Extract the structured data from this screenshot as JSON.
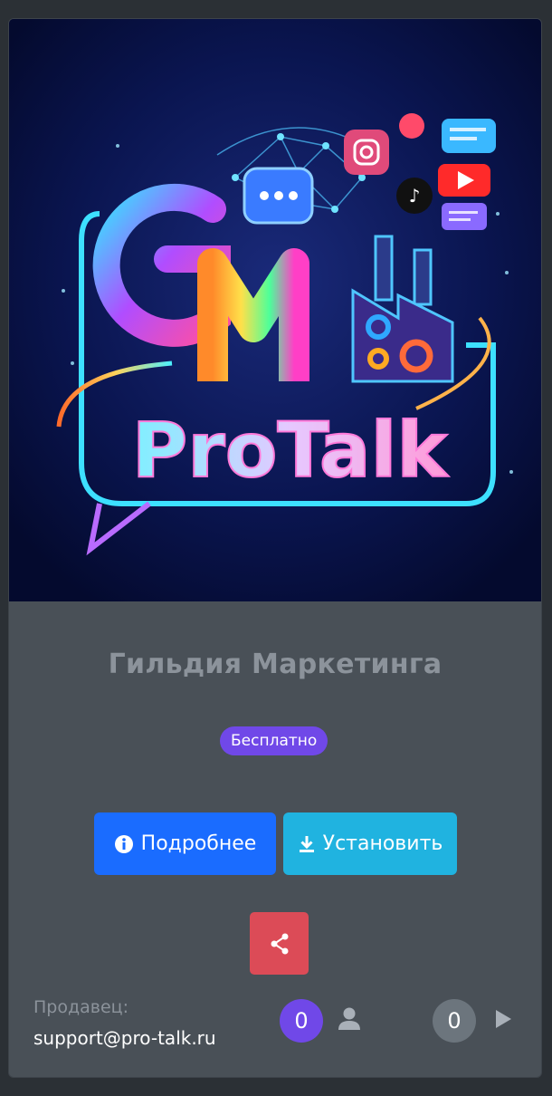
{
  "product": {
    "image_alt": "GM ProTalk logo",
    "logo_text": "ProTalk",
    "logo_letters": "GM",
    "title": "Гильдия Маркетинга",
    "price_badge": "Бесплатно"
  },
  "actions": {
    "details_label": "Подробнее",
    "install_label": "Установить",
    "share_icon": "share-icon"
  },
  "seller": {
    "label": "Продавец:",
    "email": "support@pro-talk.ru"
  },
  "stats": {
    "users_count": "0",
    "plays_count": "0"
  },
  "colors": {
    "card_bg": "#495057",
    "badge": "#7048e8",
    "primary": "#1a6cff",
    "info": "#20b3e0",
    "danger": "#dc4b57"
  }
}
